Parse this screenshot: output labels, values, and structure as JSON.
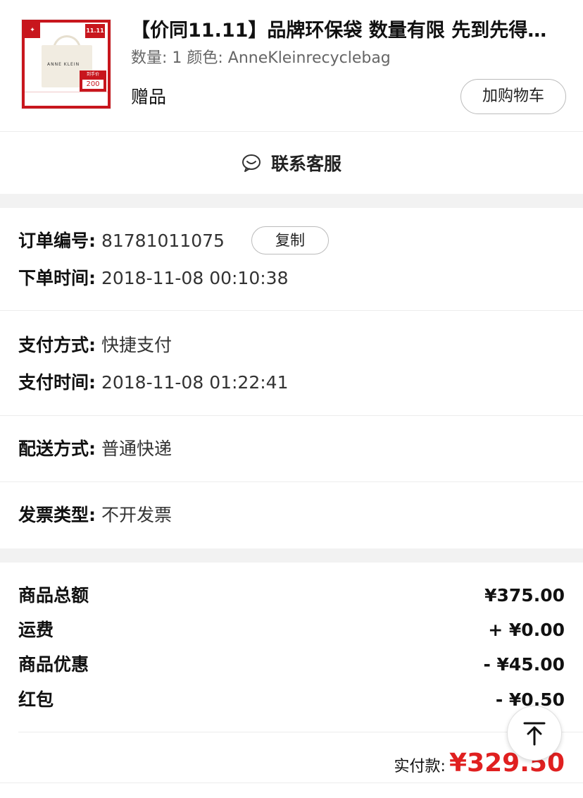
{
  "product": {
    "title": "【价同11.11】品牌环保袋 数量有限 先到先得…",
    "spec": "数量: 1 颜色: AnneKleinrecyclebag",
    "gift_label": "赠品",
    "add_to_cart_label": "加购物车",
    "thumb_text": {
      "bag_brand": "ANNE KLEIN",
      "event": "11.11",
      "price_caption": "到手价",
      "price": "200"
    }
  },
  "service": {
    "label": "联系客服",
    "icon": "chat-bubble-smile-icon"
  },
  "order": {
    "number_label": "订单编号:",
    "number_value": "81781011075",
    "copy_label": "复制",
    "time_label": "下单时间:",
    "time_value": "2018-11-08 00:10:38"
  },
  "payment": {
    "method_label": "支付方式:",
    "method_value": "快捷支付",
    "time_label": "支付时间:",
    "time_value": "2018-11-08 01:22:41"
  },
  "delivery": {
    "label": "配送方式:",
    "value": "普通快递"
  },
  "invoice": {
    "label": "发票类型:",
    "value": "不开发票"
  },
  "summary": {
    "items": [
      {
        "label": "商品总额",
        "value": "¥375.00"
      },
      {
        "label": "运费",
        "value": "+ ¥0.00"
      },
      {
        "label": "商品优惠",
        "value": "- ¥45.00"
      },
      {
        "label": "红包",
        "value": "- ¥0.50"
      }
    ],
    "paid_label": "实付款:",
    "paid_value": "¥329.50"
  },
  "colors": {
    "accent_red": "#e02020",
    "brand_red": "#c8161d"
  },
  "back_to_top_icon": "arrow-up-icon"
}
